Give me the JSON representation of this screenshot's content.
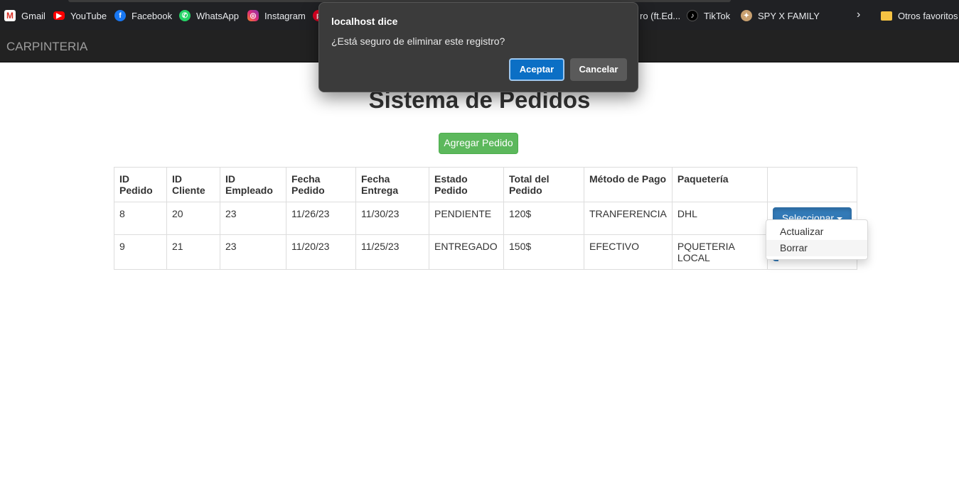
{
  "bookmarks": {
    "items": [
      {
        "label": "Gmail",
        "icon": "gmail-icon"
      },
      {
        "label": "YouTube",
        "icon": "youtube-icon"
      },
      {
        "label": "Facebook",
        "icon": "facebook-icon"
      },
      {
        "label": "WhatsApp",
        "icon": "whatsapp-icon"
      },
      {
        "label": "Instagram",
        "icon": "instagram-icon"
      },
      {
        "label": "ro (ft.Ed...",
        "icon": "music-icon"
      },
      {
        "label": "TikTok",
        "icon": "tiktok-icon"
      },
      {
        "label": "SPY X FAMILY",
        "icon": "spy-family-icon"
      }
    ],
    "other_favorites": "Otros favoritos",
    "overflow_glyph": "›"
  },
  "navbar": {
    "brand": "CARPINTERIA"
  },
  "main": {
    "title": "Sistema de Pedidos",
    "add_button": "Agregar Pedido"
  },
  "table": {
    "headers": [
      "ID Pedido",
      "ID Cliente",
      "ID Empleado",
      "Fecha Pedido",
      "Fecha Entrega",
      "Estado Pedido",
      "Total del Pedido",
      "Método de Pago",
      "Paquetería",
      ""
    ],
    "rows": [
      [
        "8",
        "20",
        "23",
        "11/26/23",
        "11/30/23",
        "PENDIENTE",
        "120$",
        "TRANFERENCIA",
        "DHL"
      ],
      [
        "9",
        "21",
        "23",
        "11/20/23",
        "11/25/23",
        "ENTREGADO",
        "150$",
        "EFECTIVO",
        "PQUETERIA LOCAL"
      ]
    ],
    "select_label": "Seleccionar"
  },
  "dropdown": {
    "items": [
      "Actualizar",
      "Borrar"
    ]
  },
  "dialog": {
    "title": "localhost dice",
    "message": "¿Está seguro de eliminar este registro?",
    "ok_label": "Aceptar",
    "cancel_label": "Cancelar"
  },
  "colors": {
    "navbar_bg": "#222222",
    "success": "#5cb85c",
    "primary": "#337ab7",
    "dialog_bg": "#3b3b3b",
    "dialog_ok": "#0b6fc5"
  }
}
